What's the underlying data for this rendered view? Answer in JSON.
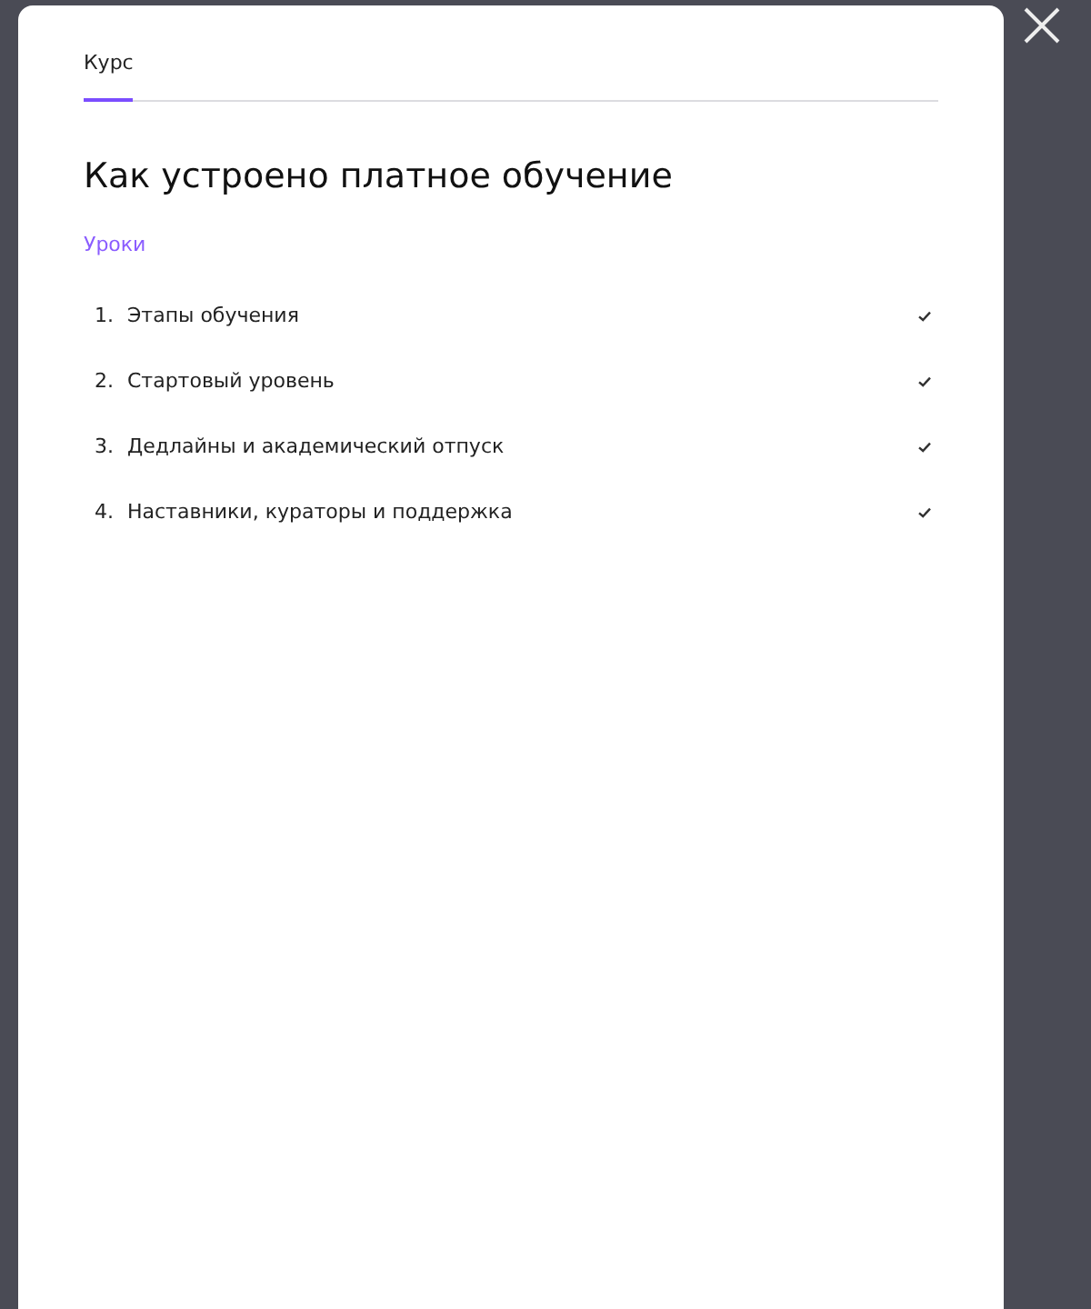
{
  "tabs": [
    {
      "label": "Курс",
      "selected": true
    }
  ],
  "title": "Как устроено платное обучение",
  "section_label": "Уроки",
  "lessons": [
    {
      "number": "1.",
      "title": "Этапы обучения",
      "done": true
    },
    {
      "number": "2.",
      "title": "Стартовый уровень",
      "done": true
    },
    {
      "number": "3.",
      "title": "Дедлайны и академический отпуск",
      "done": true
    },
    {
      "number": "4.",
      "title": "Наставники, кураторы и поддержка",
      "done": true
    }
  ]
}
